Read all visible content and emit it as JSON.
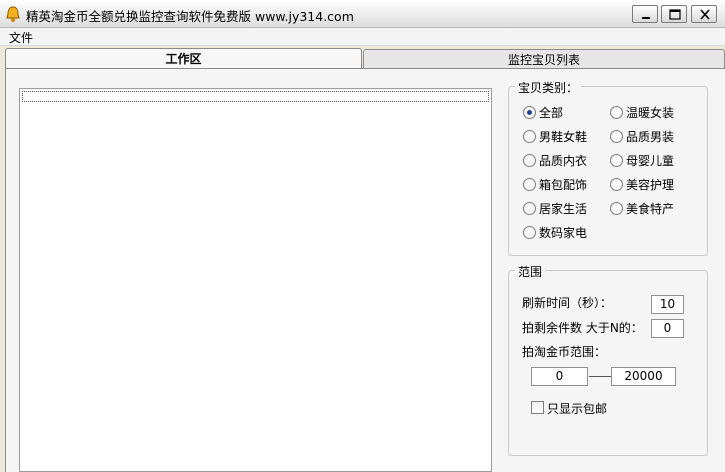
{
  "window": {
    "title": "精英淘金币全额兑换监控查询软件免费版  www.jy314.com",
    "icon": "bell-icon"
  },
  "menu": {
    "file": "文件"
  },
  "tabs": {
    "work": "工作区",
    "monitor": "监控宝贝列表"
  },
  "categories": {
    "legend": "宝贝类别：",
    "selected": "全部",
    "items": [
      "全部",
      "温暖女装",
      "男鞋女鞋",
      "品质男装",
      "品质内衣",
      "母婴儿童",
      "箱包配饰",
      "美容护理",
      "居家生活",
      "美食特产",
      "数码家电"
    ]
  },
  "range": {
    "legend": "范围",
    "refresh_label": "刷新时间（秒）：",
    "refresh_value": "10",
    "remain_label": "拍剩余件数 大于N的：",
    "remain_value": "0",
    "coin_label": "拍淘金币范围：",
    "coin_min": "0",
    "coin_max": "20000",
    "free_shipping_label": "只显示包邮"
  }
}
